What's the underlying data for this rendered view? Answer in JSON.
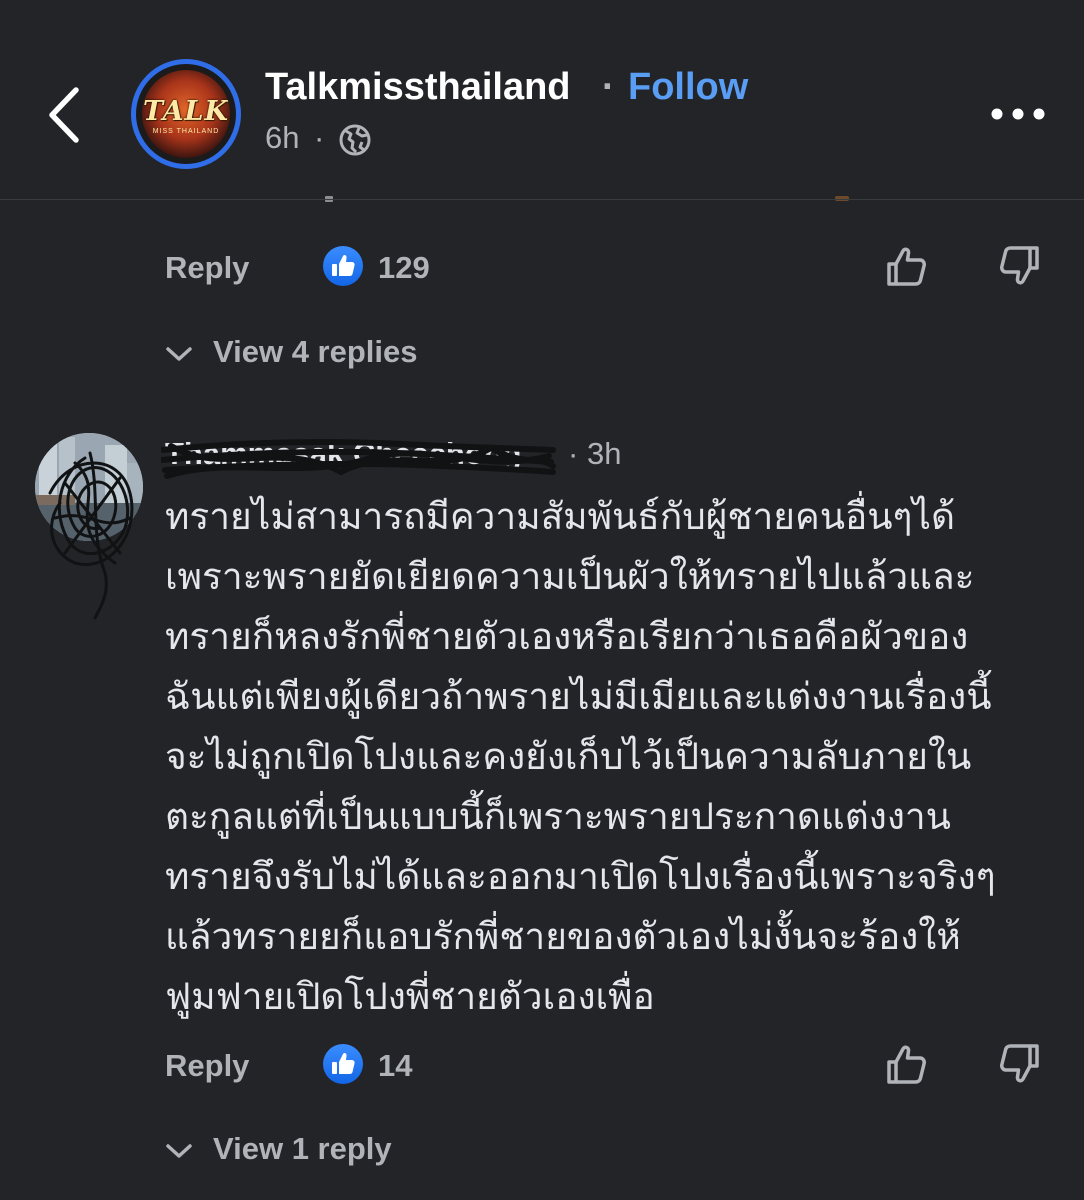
{
  "header": {
    "page_name": "Talkmissthailand",
    "separator": "·",
    "follow_label": "Follow",
    "post_age": "6h",
    "time_separator": "·",
    "avatar_logo_text": "TALK",
    "avatar_logo_subtext": "MISS THAILAND",
    "icons": [
      "back-chevron-icon",
      "globe-icon",
      "more-options-icon"
    ]
  },
  "first_comment": {
    "reply_label": "Reply",
    "like_count": "129",
    "view_replies_label": "View 4 replies"
  },
  "second_comment": {
    "author": "Thammasak Cheechong",
    "author_redacted": true,
    "time_separator": "·",
    "age": "3h",
    "body_lines": [
      "ทรายไม่สามารถมีความสัมพันธ์กับผู้ชายคนอื่นๆได้",
      "เพราะพรายยัดเยียดความเป็นผัวให้ทรายไปแล้วและ",
      "ทรายก็หลงรักพี่ชายตัวเองหรือเรียกว่าเธอคือผัวของ",
      "ฉันแต่เพียงผู้เดียวถ้าพรายไม่มีเมียและแต่งงานเรื่องนี้",
      "จะไม่ถูกเปิดโปงและคงยังเก็บไว้เป็นความลับภายใน",
      "ตะกูลแต่ที่เป็นแบบนี้ก็เพราะพรายประกาดแต่งงาน",
      "ทรายจึงรับไม่ได้และออกมาเปิดโปงเรื่องนี้เพราะจริงๆ",
      "แล้วทรายยก็แอบรักพี่ชายของตัวเองไม่งั้นจะร้องให้",
      "ฟูมฟายเปิดโปงพี่ชายตัวเองเพื่อ"
    ],
    "reply_label": "Reply",
    "like_count": "14",
    "view_replies_label": "View 1 reply"
  },
  "colors": {
    "background": "#232427",
    "primary_text": "#e4e6eb",
    "secondary_text": "#b0b3b8",
    "accent_blue": "#5a9df4",
    "like_badge_blue": "#1877f2",
    "avatar_ring": "#2f6ee8"
  }
}
